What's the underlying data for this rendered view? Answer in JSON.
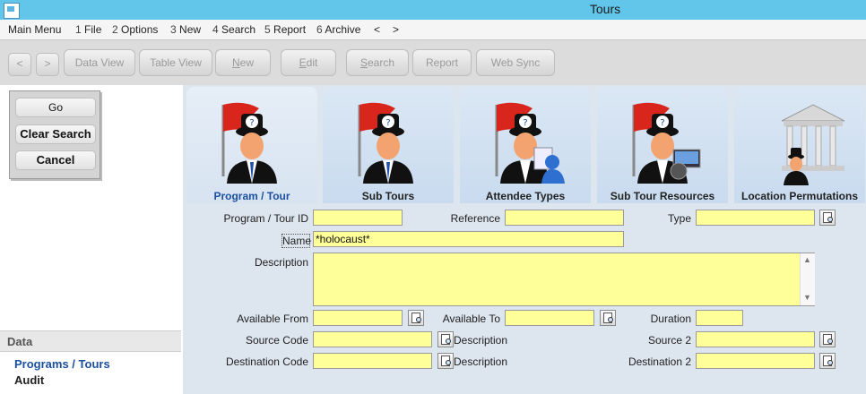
{
  "window": {
    "title": "Tours"
  },
  "menu": {
    "items": [
      {
        "label": "Main Menu"
      },
      {
        "num": "1",
        "label": "File"
      },
      {
        "num": "2",
        "label": "Options"
      },
      {
        "num": "3",
        "label": "New"
      },
      {
        "num": "4",
        "label": "Search"
      },
      {
        "num": "5",
        "label": "Report"
      },
      {
        "num": "6",
        "label": "Archive"
      }
    ],
    "prev": "<",
    "next": ">"
  },
  "toolbar": {
    "back": "<",
    "forward": ">",
    "data_view": "Data View",
    "table_view": "Table View",
    "new_pre": "",
    "new_u": "N",
    "new_post": "ew",
    "edit_pre": "",
    "edit_u": "E",
    "edit_post": "dit",
    "search_pre": "",
    "search_u": "S",
    "search_post": "earch",
    "report": "Report",
    "web_sync": "Web Sync"
  },
  "search_panel": {
    "go": "Go",
    "clear": "Clear Search",
    "cancel": "Cancel"
  },
  "data_panel": {
    "header": "Data",
    "items": [
      "Programs / Tours",
      "Audit"
    ]
  },
  "tabs": [
    {
      "label": "Program / Tour",
      "icon": "flag-person-icon"
    },
    {
      "label": "Sub Tours",
      "icon": "flag-person-icon"
    },
    {
      "label": "Attendee Types",
      "icon": "flag-person-users-icon"
    },
    {
      "label": "Sub Tour Resources",
      "icon": "flag-person-devices-icon"
    },
    {
      "label": "Location Permutations",
      "icon": "building-person-icon"
    }
  ],
  "form": {
    "program_tour_id": {
      "label": "Program / Tour ID",
      "value": ""
    },
    "reference": {
      "label": "Reference",
      "value": ""
    },
    "type": {
      "label": "Type",
      "value": ""
    },
    "name": {
      "label": "Name",
      "value": "*holocaust*"
    },
    "description": {
      "label": "Description",
      "value": ""
    },
    "available_from": {
      "label": "Available From",
      "value": ""
    },
    "available_to": {
      "label": "Available To",
      "value": ""
    },
    "duration": {
      "label": "Duration",
      "value": ""
    },
    "source_code": {
      "label": "Source Code",
      "value": ""
    },
    "source_description": {
      "label": "Description"
    },
    "source2": {
      "label": "Source 2",
      "value": ""
    },
    "destination_code": {
      "label": "Destination Code",
      "value": ""
    },
    "destination_description": {
      "label": "Description"
    },
    "destination2": {
      "label": "Destination 2",
      "value": ""
    }
  },
  "colors": {
    "titlebar": "#62c6ea",
    "field": "#ffff99",
    "tab_active_label": "#1b4fa0",
    "data_link": "#1b4fa0"
  }
}
